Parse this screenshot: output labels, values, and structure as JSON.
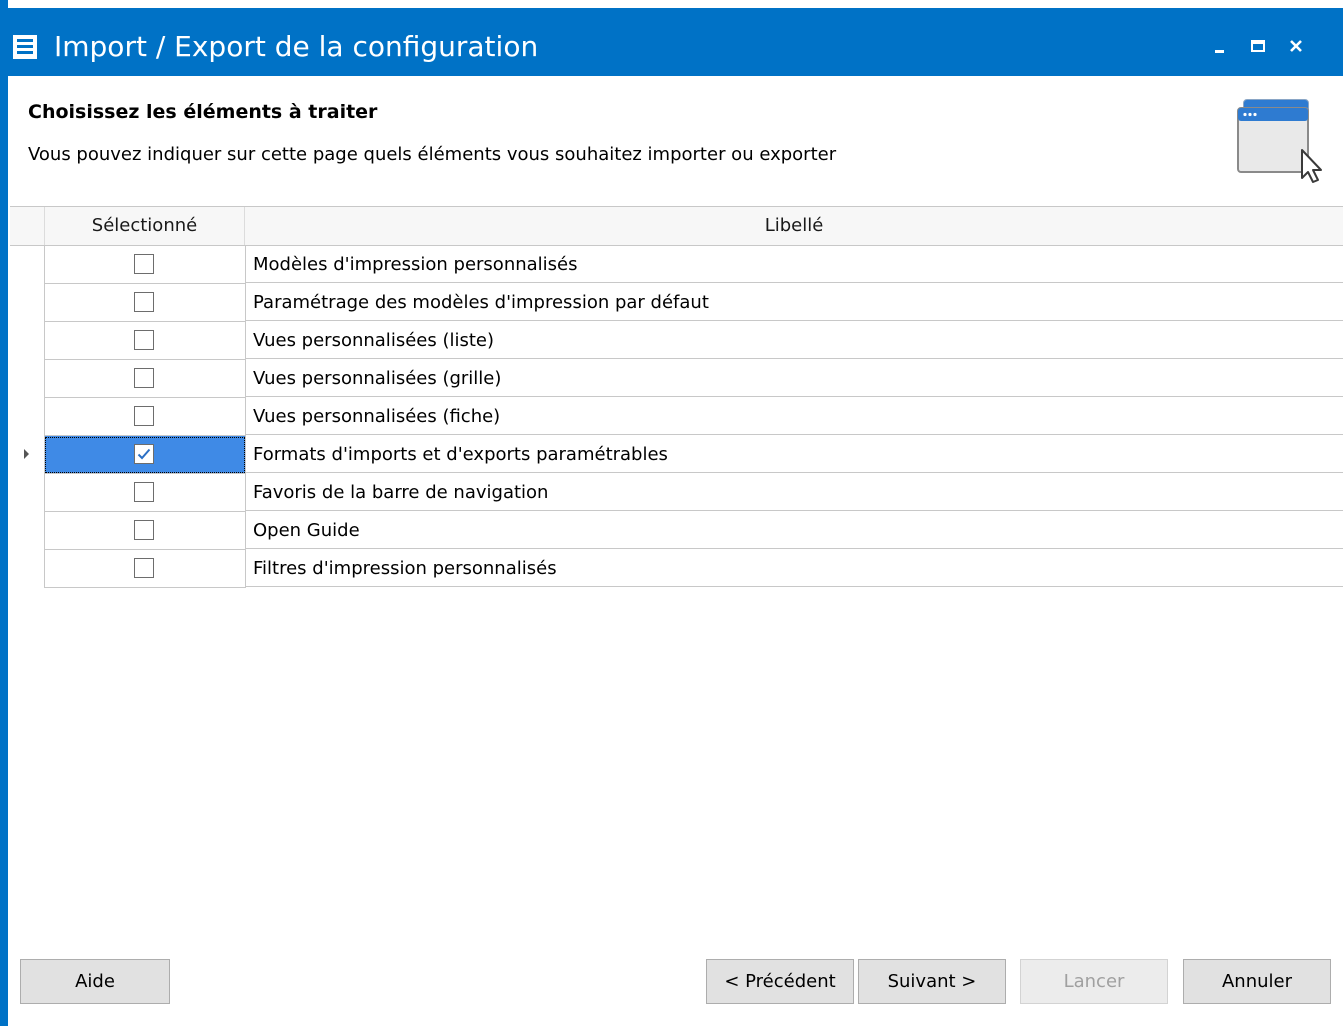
{
  "window": {
    "title": "Import / Export de la configuration",
    "title_bar_color": "#0072c6",
    "controls": [
      "minimize-icon",
      "maximize-icon",
      "close-icon"
    ]
  },
  "page": {
    "heading": "Choisissez les éléments à traiter",
    "description": "Vous pouvez indiquer sur cette page quels éléments vous souhaitez importer ou exporter",
    "icon": "window-cursor-icon"
  },
  "grid": {
    "columns": [
      "Sélectionné",
      "Libellé"
    ],
    "selection_color": "#3f8ae6",
    "rows": [
      {
        "label": "Modèles d'impression personnalisés",
        "checked": false,
        "current": false
      },
      {
        "label": "Paramétrage des modèles d'impression par défaut",
        "checked": false,
        "current": false
      },
      {
        "label": "Vues personnalisées (liste)",
        "checked": false,
        "current": false
      },
      {
        "label": "Vues personnalisées (grille)",
        "checked": false,
        "current": false
      },
      {
        "label": "Vues personnalisées (fiche)",
        "checked": false,
        "current": false
      },
      {
        "label": "Formats d'imports et d'exports paramétrables",
        "checked": true,
        "current": true
      },
      {
        "label": "Favoris de la barre de navigation",
        "checked": false,
        "current": false
      },
      {
        "label": "Open Guide",
        "checked": false,
        "current": false
      },
      {
        "label": "Filtres d'impression personnalisés",
        "checked": false,
        "current": false
      }
    ]
  },
  "footer": {
    "help": "Aide",
    "previous": "< Précédent",
    "next": "Suivant >",
    "launch": "Lancer",
    "launch_disabled": true,
    "cancel": "Annuler"
  }
}
